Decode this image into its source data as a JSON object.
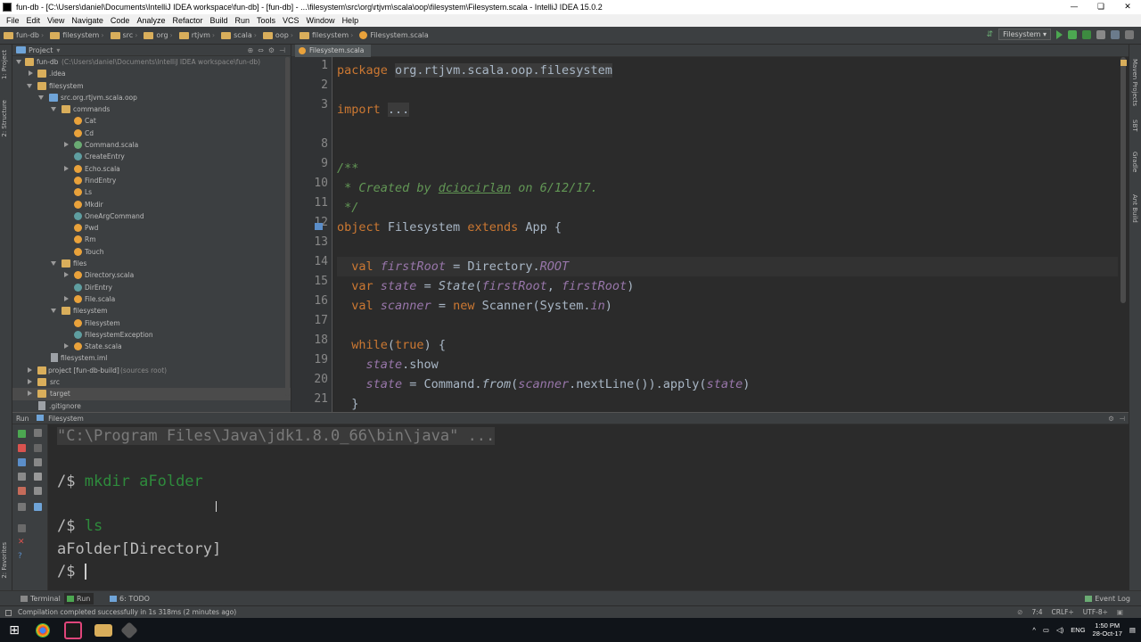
{
  "window": {
    "title": "fun-db - [C:\\Users\\daniel\\Documents\\IntelliJ IDEA workspace\\fun-db] - [fun-db] - ...\\filesystem\\src\\org\\rtjvm\\scala\\oop\\filesystem\\Filesystem.scala - IntelliJ IDEA 15.0.2",
    "controls": [
      "—",
      "❏",
      "✕"
    ]
  },
  "menu": [
    "File",
    "Edit",
    "View",
    "Navigate",
    "Code",
    "Analyze",
    "Refactor",
    "Build",
    "Run",
    "Tools",
    "VCS",
    "Window",
    "Help"
  ],
  "breadcrumb": [
    "fun-db",
    "filesystem",
    "src",
    "org",
    "rtjvm",
    "scala",
    "oop",
    "filesystem",
    "Filesystem.scala"
  ],
  "run_config": "Filesystem",
  "left_stripe": [
    "1: Project",
    "2: Structure",
    "2: Favorites"
  ],
  "right_stripe": [
    "Maven Projects",
    "SBT",
    "Gradle",
    "Ant Build"
  ],
  "project_panel": {
    "title": "Project",
    "tree": [
      {
        "label": "fun-db",
        "note": "(C:\\Users\\daniel\\Documents\\IntelliJ IDEA workspace\\fun-db)",
        "icon": "folder",
        "arrow": "down"
      },
      {
        "label": ".idea",
        "icon": "folder",
        "arrow": "right"
      },
      {
        "label": "filesystem",
        "icon": "folder",
        "arrow": "down"
      },
      {
        "label": "src.org.rtjvm.scala.oop",
        "icon": "folder-blue",
        "arrow": "down"
      },
      {
        "label": "commands",
        "icon": "folder",
        "arrow": "down"
      },
      {
        "label": "Cat",
        "icon": "object"
      },
      {
        "label": "Cd",
        "icon": "object"
      },
      {
        "label": "Command.scala",
        "icon": "trait",
        "arrow": "right"
      },
      {
        "label": "CreateEntry",
        "icon": "class"
      },
      {
        "label": "Echo.scala",
        "icon": "object",
        "arrow": "right"
      },
      {
        "label": "FindEntry",
        "icon": "object"
      },
      {
        "label": "Ls",
        "icon": "object"
      },
      {
        "label": "Mkdir",
        "icon": "object"
      },
      {
        "label": "OneArgCommand",
        "icon": "class"
      },
      {
        "label": "Pwd",
        "icon": "object"
      },
      {
        "label": "Rm",
        "icon": "object"
      },
      {
        "label": "Touch",
        "icon": "object"
      },
      {
        "label": "files",
        "icon": "folder",
        "arrow": "down"
      },
      {
        "label": "Directory.scala",
        "icon": "object",
        "arrow": "right"
      },
      {
        "label": "DirEntry",
        "icon": "class"
      },
      {
        "label": "File.scala",
        "icon": "object",
        "arrow": "right"
      },
      {
        "label": "filesystem",
        "icon": "folder",
        "arrow": "down"
      },
      {
        "label": "Filesystem",
        "icon": "object"
      },
      {
        "label": "FilesystemException",
        "icon": "class"
      },
      {
        "label": "State.scala",
        "icon": "object",
        "arrow": "right"
      },
      {
        "label": "filesystem.iml",
        "icon": "file"
      },
      {
        "label": "project [fun-db-build]",
        "note": "(sources root)",
        "icon": "folder",
        "arrow": "right"
      },
      {
        "label": "src",
        "icon": "folder",
        "arrow": "right"
      },
      {
        "label": "target",
        "icon": "folder",
        "arrow": "right"
      },
      {
        "label": ".gitignore",
        "icon": "file"
      }
    ]
  },
  "editor": {
    "tab": "Filesystem.scala",
    "line_numbers": [
      "1",
      "2",
      "3",
      "8",
      "9",
      "10",
      "11",
      "12",
      "13",
      "14",
      "15",
      "16",
      "17",
      "18",
      "19",
      "20",
      "21"
    ],
    "code": {
      "l1_kw": "package",
      "l1_pkg": "org.rtjvm.scala.oop.filesystem",
      "l3_kw": "import",
      "l3_rest": "...",
      "l9": "/**",
      "l10_pre": " * Created by ",
      "l10_user": "dciocirlan",
      "l10_post": " on 6/12/17.",
      "l11": " */",
      "l12_kw1": "object",
      "l12_name": " Filesystem ",
      "l12_kw2": "extends",
      "l12_rest": " App {",
      "l14_kw": "val",
      "l14_var": "firstRoot",
      "l14_mid": " = Directory.",
      "l14_fld": "ROOT",
      "l15_kw": "var",
      "l15_var": "state",
      "l15_mid": " = ",
      "l15_call": "State",
      "l15_open": "(",
      "l15_a1": "firstRoot",
      "l15_sep": ", ",
      "l15_a2": "firstRoot",
      "l15_close": ")",
      "l16_kw": "val",
      "l16_var": "scanner",
      "l16_mid": " = ",
      "l16_new": "new",
      "l16_rest": " Scanner(System.",
      "l16_in": "in",
      "l16_end": ")",
      "l18_kw": "while",
      "l18_open": "(",
      "l18_true": "true",
      "l18_close": ") {",
      "l19_var": "state",
      "l19_rest": ".show",
      "l20_var": "state",
      "l20_mid": " = Command.",
      "l20_from": "from",
      "l20_open": "(",
      "l20_sc": "scanner",
      "l20_rest": ".nextLine()).apply(",
      "l20_st": "state",
      "l20_end": ")",
      "l21": "}"
    }
  },
  "run_panel": {
    "label": "Run",
    "config": "Filesystem",
    "console": {
      "java_cmd": "\"C:\\Program Files\\Java\\jdk1.8.0_66\\bin\\java\" ...",
      "prompt": "/$ ",
      "cmd1": "mkdir aFolder",
      "cmd2": "ls",
      "output1": "aFolder[Directory]"
    }
  },
  "bottom_tabs": [
    "Terminal",
    "Run",
    "6: TODO"
  ],
  "event_log": "Event Log",
  "status": {
    "message": "Compilation completed successfully in 1s 318ms (2 minutes ago)",
    "position": "7:4",
    "line_sep": "CRLF÷",
    "encoding": "UTF-8÷"
  },
  "taskbar": {
    "lang": "ENG",
    "time": "1:50 PM",
    "date": "28-Oct-17"
  }
}
